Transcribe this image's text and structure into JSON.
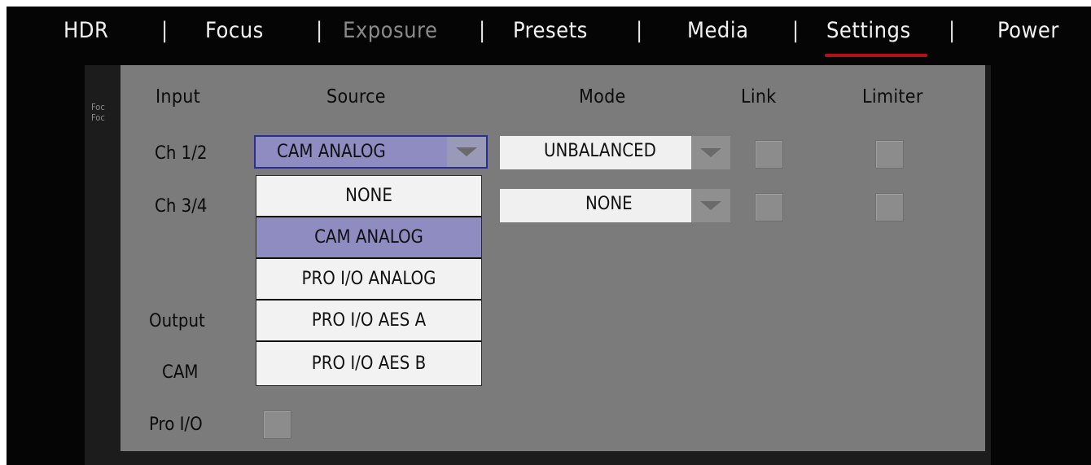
{
  "menu": {
    "items": [
      {
        "label": "HDR",
        "state": "normal"
      },
      {
        "label": "Focus",
        "state": "normal"
      },
      {
        "label": "Exposure",
        "state": "disabled"
      },
      {
        "label": "Presets",
        "state": "normal"
      },
      {
        "label": "Media",
        "state": "normal"
      },
      {
        "label": "Settings",
        "state": "active"
      },
      {
        "label": "Power",
        "state": "normal"
      }
    ],
    "separator": "|",
    "active_underline_color": "#b31218"
  },
  "background": {
    "line1": "Foc",
    "line2": "Foc"
  },
  "dialog": {
    "headers": {
      "input": "Input",
      "source": "Source",
      "mode": "Mode",
      "link": "Link",
      "limiter": "Limiter"
    },
    "rows": [
      {
        "label": "Ch 1/2",
        "source": "CAM ANALOG",
        "mode": "UNBALANCED",
        "link": false,
        "limiter": false
      },
      {
        "label": "Ch 3/4",
        "mode": "NONE",
        "link": false,
        "limiter": false
      }
    ],
    "output_label": "Output",
    "cam_label": "CAM",
    "pro_io_label": "Pro I/O",
    "pro_io_checked": false,
    "source_dropdown": {
      "options": [
        "NONE",
        "CAM ANALOG",
        "PRO I/O ANALOG",
        "PRO I/O AES A",
        "PRO I/O AES B"
      ],
      "selected": "CAM ANALOG"
    },
    "colors": {
      "panel": "#7b7b7b",
      "selected": "#8e8cc1",
      "focus_border": "#2a2f8c"
    }
  }
}
